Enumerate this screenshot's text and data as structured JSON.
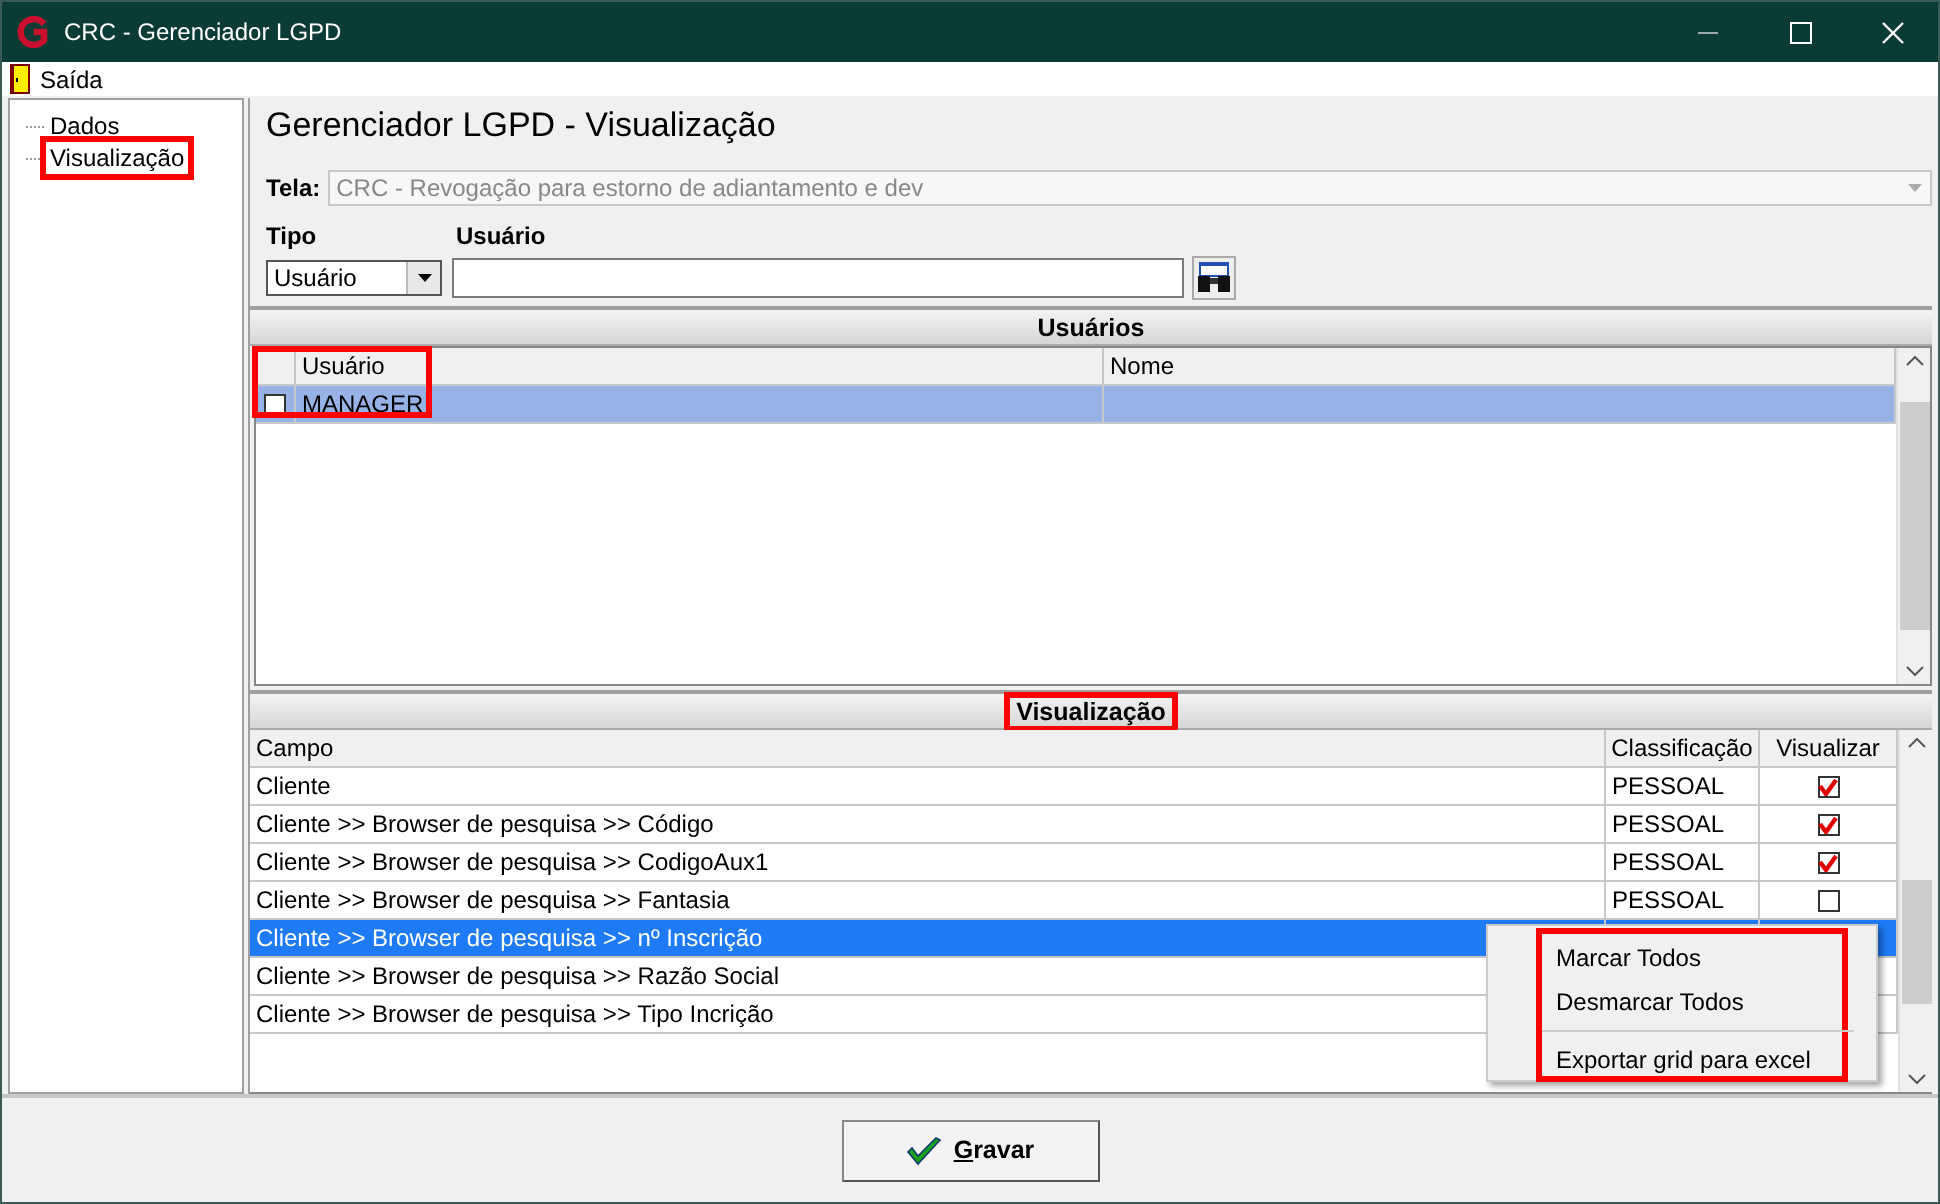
{
  "window": {
    "title": "CRC - Gerenciador LGPD"
  },
  "menu": [
    {
      "label": "Saída"
    }
  ],
  "tree": [
    {
      "label": "Dados",
      "highlighted": false
    },
    {
      "label": "Visualização",
      "highlighted": true
    }
  ],
  "heading": "Gerenciador LGPD - Visualização",
  "tela": {
    "label": "Tela:",
    "value": "CRC - Revogação para estorno de adiantamento e dev",
    "disabled": true
  },
  "tipo": {
    "label": "Tipo",
    "value": "Usuário"
  },
  "usuario": {
    "label": "Usuário"
  },
  "users_panel": {
    "title": "Usuários",
    "highlighted": true,
    "columns": [
      "Usuário",
      "Nome"
    ],
    "rows": [
      {
        "usuario": "MANAGER",
        "checked": false,
        "selected": true
      }
    ]
  },
  "view_panel": {
    "title": "Visualização",
    "highlighted": true,
    "columns": [
      "Campo",
      "Classificação",
      "Visualizar"
    ],
    "rows": [
      {
        "campo": "Cliente",
        "classificacao": "PESSOAL",
        "checked": true,
        "selected": false
      },
      {
        "campo": "Cliente >> Browser de pesquisa >> Código",
        "classificacao": "PESSOAL",
        "checked": true,
        "selected": false
      },
      {
        "campo": "Cliente >> Browser de pesquisa >> CodigoAux1",
        "classificacao": "PESSOAL",
        "checked": true,
        "selected": false
      },
      {
        "campo": "Cliente >> Browser de pesquisa >> Fantasia",
        "classificacao": "PESSOAL",
        "checked": false,
        "selected": false
      },
      {
        "campo": "Cliente >> Browser de pesquisa >> nº Inscrição",
        "selected": true
      },
      {
        "campo": "Cliente >> Browser de pesquisa >> Razão Social",
        "selected": false
      },
      {
        "campo": "Cliente >> Browser de pesquisa >> Tipo Incrição",
        "selected": false
      }
    ]
  },
  "context_menu": {
    "highlighted": true,
    "items": [
      {
        "kind": "item",
        "label": "Marcar Todos"
      },
      {
        "kind": "item",
        "label": "Desmarcar Todos"
      },
      {
        "kind": "separator"
      },
      {
        "kind": "item",
        "label": "Exportar grid para excel"
      }
    ]
  },
  "save_button": {
    "label": "Gravar"
  }
}
